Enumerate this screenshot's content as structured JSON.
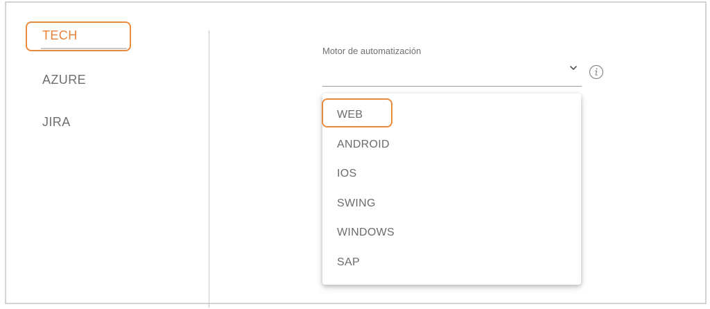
{
  "sidebar": {
    "items": [
      {
        "label": "TECH",
        "active": true
      },
      {
        "label": "AZURE",
        "active": false
      },
      {
        "label": "JIRA",
        "active": false
      }
    ]
  },
  "automation_engine": {
    "label": "Motor de automatización",
    "value": "",
    "options": [
      "WEB",
      "ANDROID",
      "IOS",
      "SWING",
      "WINDOWS",
      "SAP"
    ],
    "highlighted_option": "WEB"
  },
  "icons": {
    "chevron": "chevron-down-icon",
    "info": "info-icon"
  },
  "colors": {
    "accent": "#e8823a",
    "highlight": "#ec8a3c",
    "text": "#6e6e6e",
    "divider": "#c8c8c8"
  }
}
